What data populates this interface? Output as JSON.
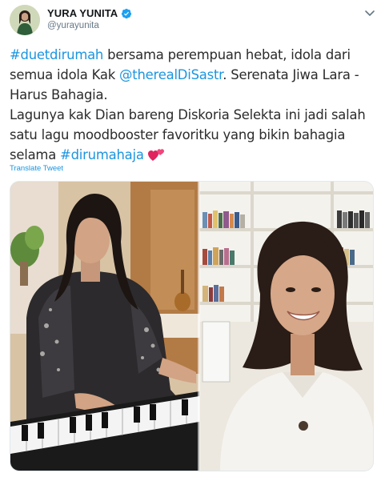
{
  "author": {
    "display_name": "YURA YUNITA",
    "handle": "@yurayunita",
    "verified": true
  },
  "tweet": {
    "hashtag_duet": "#duetdirumah",
    "text_part1": " bersama perempuan hebat, idola dari semua idola Kak ",
    "mention": "@therealDiSastr",
    "text_part2": ". Serenata Jiwa Lara - Harus Bahagia.",
    "paragraph2": "Lagunya kak Dian bareng Diskoria Selekta ini jadi salah satu lagu moodbooster favoritku yang bikin bahagia selama ",
    "hashtag_end": "#dirumahaja",
    "emoji": "two-hearts-icon"
  },
  "translate_label": "Translate Tweet",
  "colors": {
    "link": "#1b95e0",
    "verified": "#1da1f2",
    "secondary_text": "#657786",
    "heart": "#e0245e"
  },
  "media": {
    "type": "video-split",
    "left_panel": "woman-playing-keyboard",
    "right_panel": "smiling-woman-bookshelf"
  }
}
